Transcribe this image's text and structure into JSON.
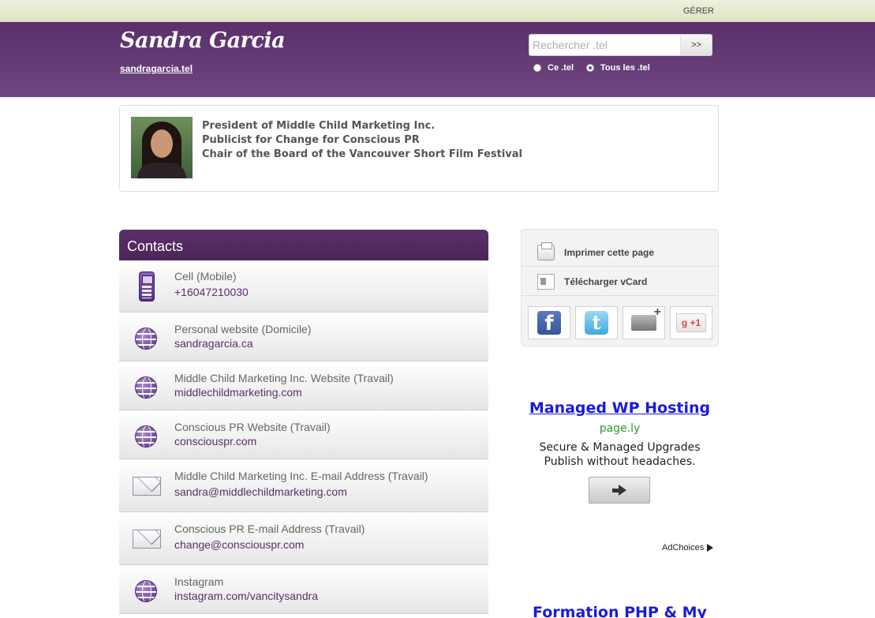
{
  "topbar": {
    "manage_label": "GÉRER"
  },
  "header": {
    "title": "Sandra Garcia",
    "url": "sandragarcia.tel",
    "search": {
      "placeholder": "Rechercher .tel",
      "button_label": ">>"
    },
    "scope_options": [
      {
        "label": "Ce .tel",
        "selected": false
      },
      {
        "label": "Tous les .tel",
        "selected": true
      }
    ]
  },
  "profile": {
    "bio_lines": [
      "President of Middle Child Marketing Inc.",
      "Publicist for Change for Conscious PR",
      "Chair of the Board of the Vancouver Short Film Festival"
    ]
  },
  "contacts": {
    "heading": "Contacts",
    "items": [
      {
        "icon": "mobile-phone-icon",
        "label": "Cell (Mobile)",
        "value": "+16047210030"
      },
      {
        "icon": "globe-icon",
        "label": "Personal website (Domicile)",
        "value": "sandragarcia.ca"
      },
      {
        "icon": "globe-icon",
        "label": "Middle Child Marketing Inc. Website (Travail)",
        "value": "middlechildmarketing.com"
      },
      {
        "icon": "globe-icon",
        "label": "Conscious PR Website (Travail)",
        "value": "consciouspr.com"
      },
      {
        "icon": "envelope-icon",
        "label": "Middle Child Marketing Inc. E-mail Address (Travail)",
        "value": "sandra@middlechildmarketing.com"
      },
      {
        "icon": "envelope-icon",
        "label": "Conscious PR E-mail Address (Travail)",
        "value": "change@consciouspr.com"
      },
      {
        "icon": "globe-icon",
        "label": "Instagram",
        "value": "instagram.com/vancitysandra"
      }
    ]
  },
  "sidebar": {
    "print_label": "Imprimer cette page",
    "vcard_label": "Télécharger vCard",
    "share": [
      {
        "icon": "facebook-icon",
        "glyph": "f"
      },
      {
        "icon": "twitter-icon",
        "glyph": "t"
      },
      {
        "icon": "email-add-icon",
        "glyph": ""
      },
      {
        "icon": "google-plus-icon",
        "glyph": "g +1"
      }
    ]
  },
  "ad": {
    "title": "Managed WP Hosting",
    "domain": "page.ly",
    "line1": "Secure & Managed Upgrades",
    "line2": "Publish without headaches.",
    "adchoices": "AdChoices",
    "next_title": "Formation PHP & My"
  },
  "colors": {
    "brand_purple": "#5a2f6a",
    "link_purple": "#5a2f6a",
    "ad_link": "#1a1add",
    "ad_green": "#2a9a2a"
  }
}
